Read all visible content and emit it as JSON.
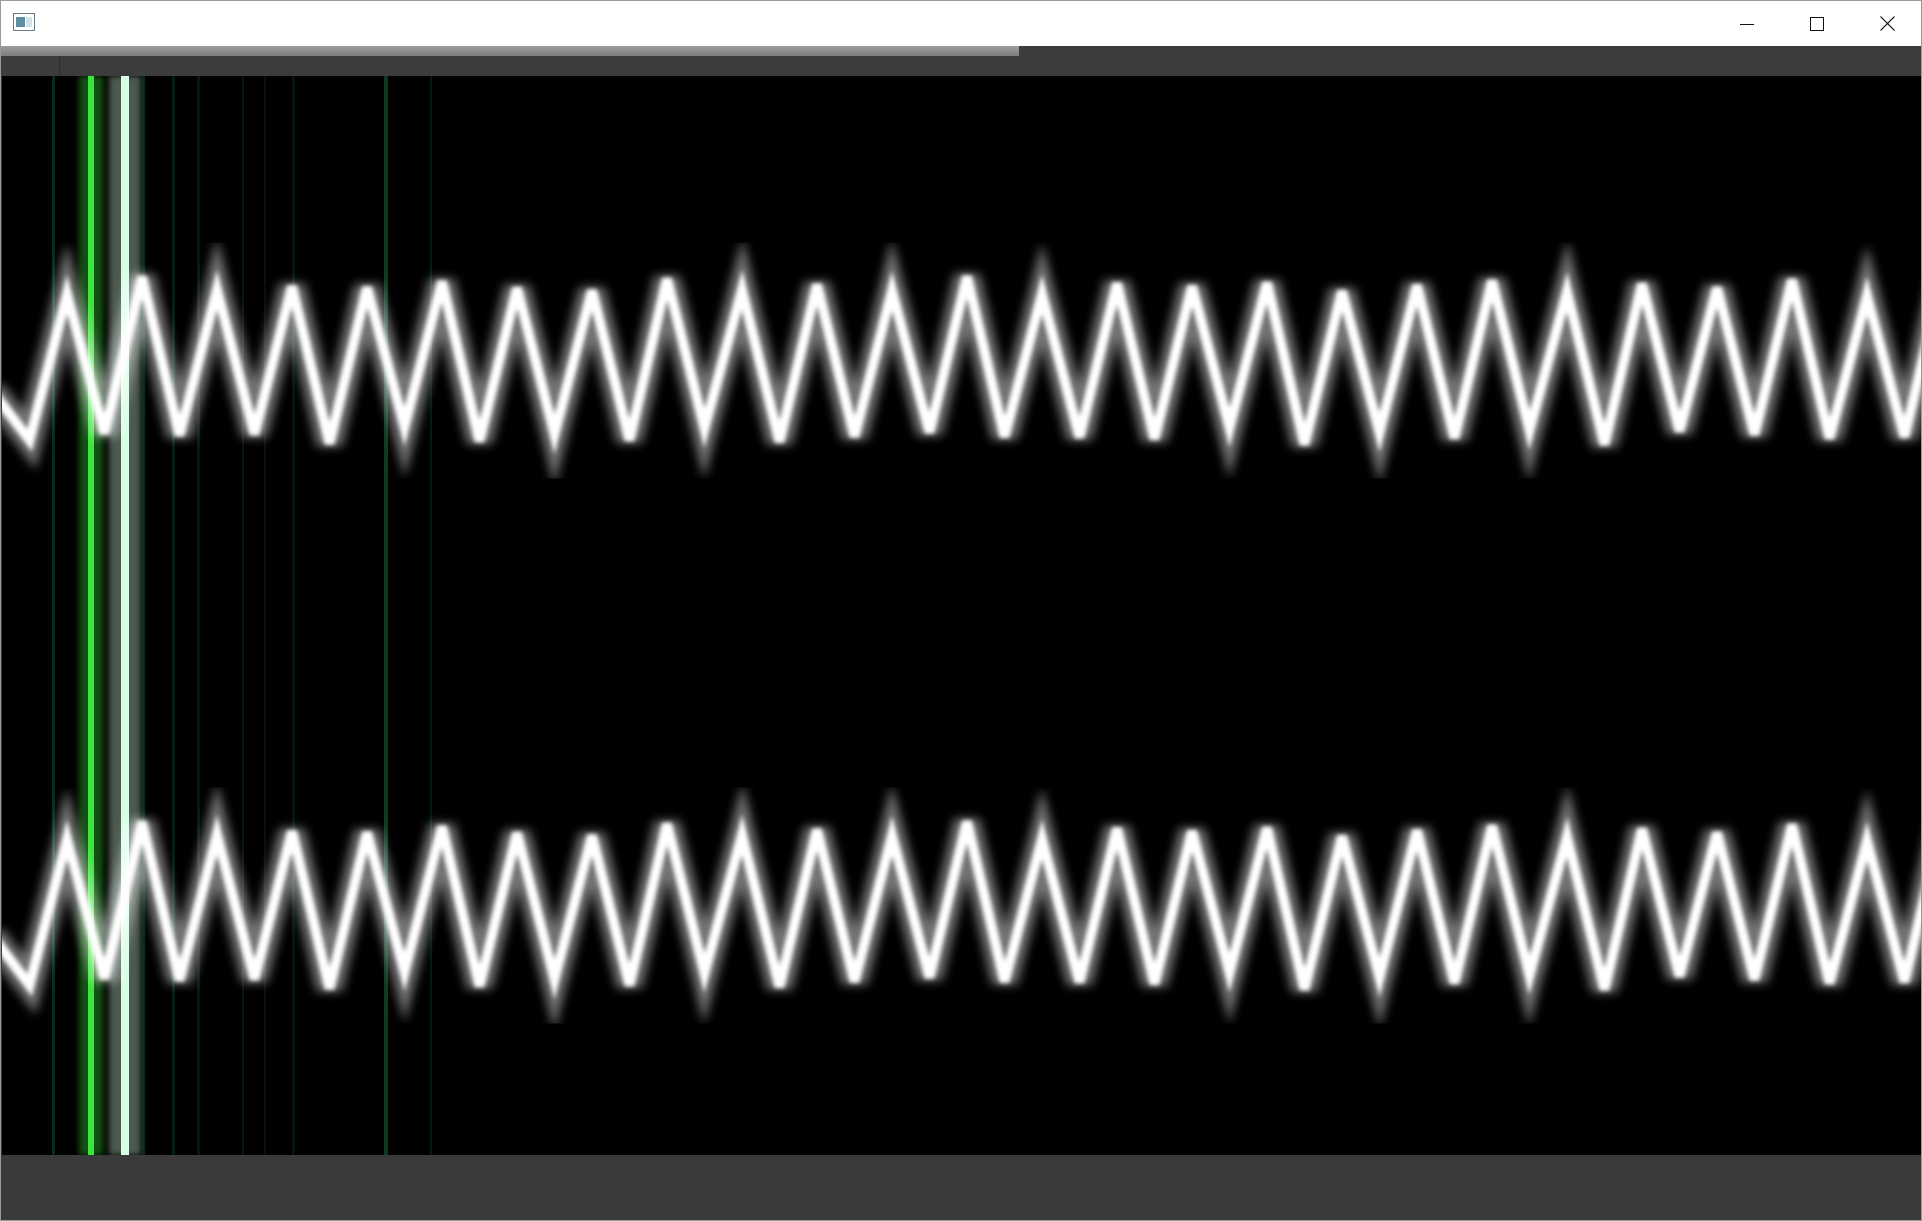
{
  "window": {
    "title": "",
    "icon": "app-window-icon",
    "controls": {
      "minimize": "minimize-icon",
      "maximize": "maximize-icon",
      "close": "close-icon"
    }
  },
  "playback": {
    "progress_fraction": 0.53
  },
  "visualizer": {
    "background": "#000000",
    "waveform_color": "#ffffff",
    "marker_colors": {
      "primary": "#39e639",
      "secondary": "#d8ffe6",
      "dim": "#0f4a2a"
    },
    "channels": 2
  }
}
